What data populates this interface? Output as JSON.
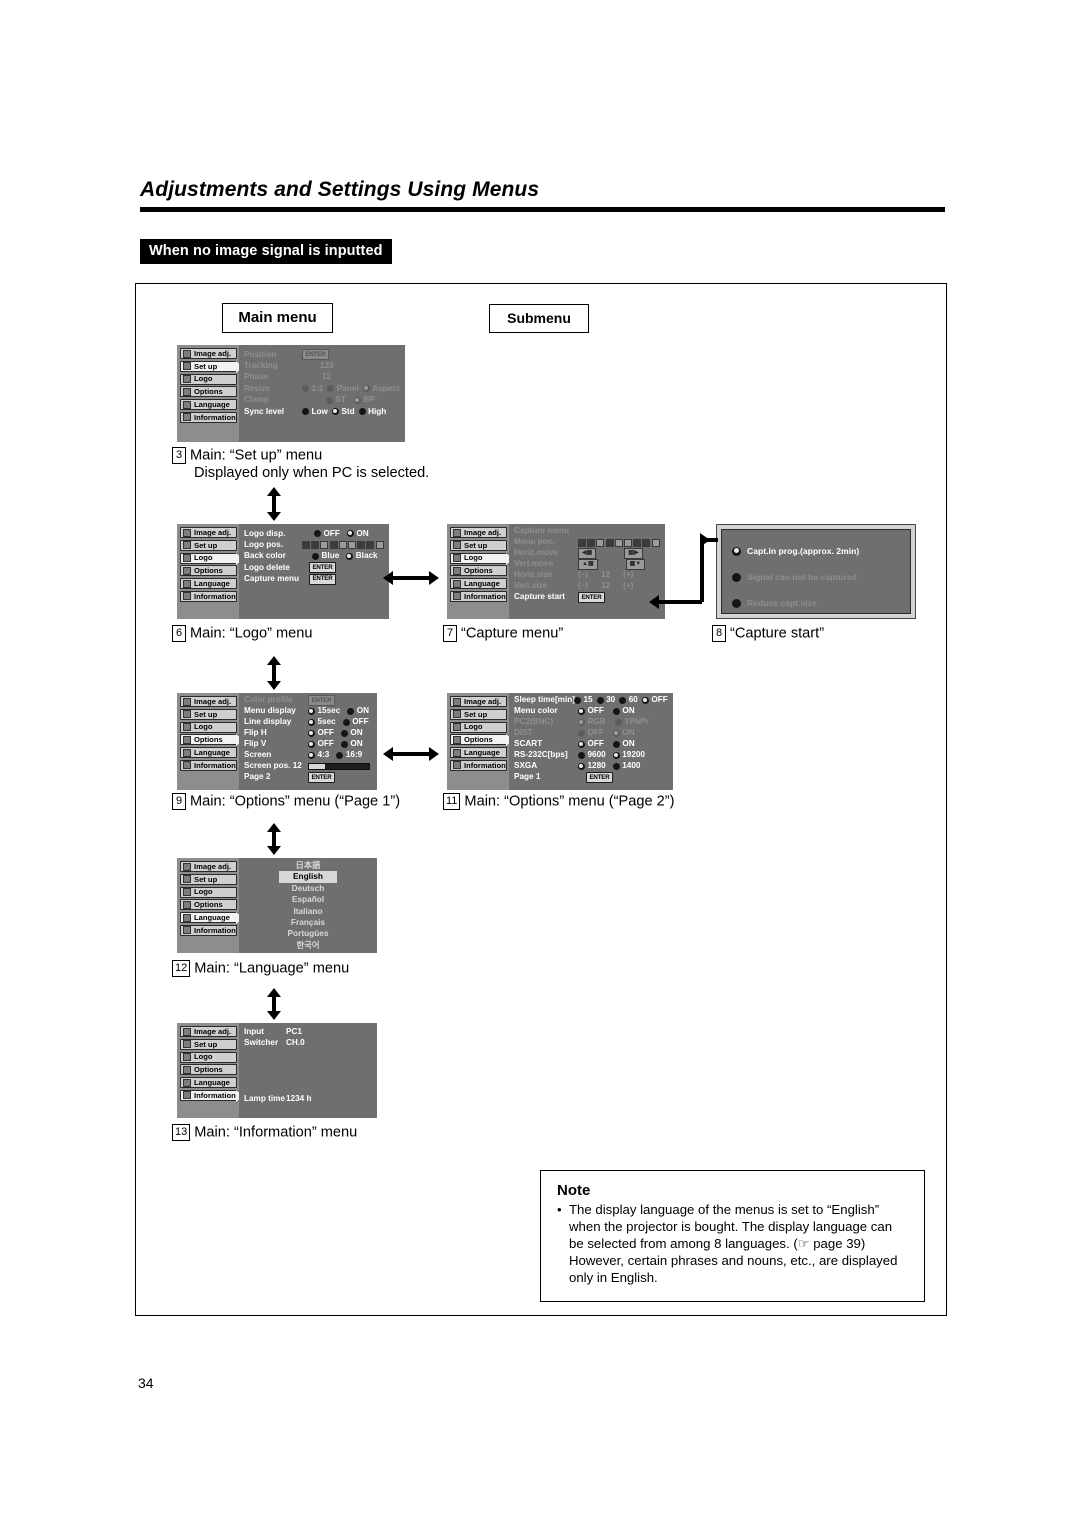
{
  "page": {
    "header_title": "Adjustments and Settings Using Menus",
    "section_tag": "When no image signal is inputted",
    "page_number": "34"
  },
  "legend": {
    "main_menu": "Main menu",
    "submenu": "Submenu"
  },
  "sidebar_items": [
    {
      "label": "Image adj.",
      "icon": "image-adjust-icon"
    },
    {
      "label": "Set up",
      "icon": "setup-icon"
    },
    {
      "label": "Logo",
      "icon": "logo-icon"
    },
    {
      "label": "Options",
      "icon": "options-icon"
    },
    {
      "label": "Language",
      "icon": "language-icon"
    },
    {
      "label": "Information",
      "icon": "information-icon"
    }
  ],
  "menus": {
    "setup": {
      "selected_sidebar": "Set up",
      "rows": [
        {
          "label": "Position",
          "dim": true,
          "value_type": "enter",
          "enter": "ENTER"
        },
        {
          "label": "Tracking",
          "dim": true,
          "value_type": "text",
          "text": "123"
        },
        {
          "label": "Phase",
          "dim": true,
          "value_type": "text",
          "text": "12"
        },
        {
          "label": "Resize",
          "dim": true,
          "value_type": "radio",
          "options": [
            "1:1",
            "Panel",
            "Aspect"
          ],
          "selected": "Aspect"
        },
        {
          "label": "Clamp",
          "dim": true,
          "value_type": "radio",
          "options": [
            "ST",
            "BP"
          ],
          "selected": "BP"
        },
        {
          "label": "Sync level",
          "dim": false,
          "value_type": "radio",
          "options": [
            "Low",
            "Std",
            "High"
          ],
          "selected": "Std"
        }
      ]
    },
    "logo": {
      "selected_sidebar": "Logo",
      "rows": [
        {
          "label": "Logo disp.",
          "dim": false,
          "value_type": "radio",
          "options": [
            "OFF",
            "ON"
          ],
          "selected": "ON"
        },
        {
          "label": "Logo pos.",
          "dim": false,
          "value_type": "posgrid"
        },
        {
          "label": "Back color",
          "dim": false,
          "value_type": "radio",
          "options": [
            "Blue",
            "Black"
          ],
          "selected": "Black"
        },
        {
          "label": "Logo delete",
          "dim": false,
          "value_type": "enter",
          "enter": "ENTER"
        },
        {
          "label": "Capture menu",
          "dim": false,
          "value_type": "enter",
          "enter": "ENTER"
        }
      ]
    },
    "capture": {
      "selected_sidebar": "Logo",
      "rows": [
        {
          "label": "Capture menu",
          "dim": true,
          "value_type": "none"
        },
        {
          "label": "Menu pos.",
          "dim": true,
          "value_type": "posgrid"
        },
        {
          "label": "Horiz.move",
          "dim": true,
          "value_type": "move",
          "left": "◀▦",
          "right": "▦▶"
        },
        {
          "label": "Vert.move",
          "dim": true,
          "value_type": "move",
          "left": "▲▦",
          "right": "▦▼"
        },
        {
          "label": "Horiz.size",
          "dim": true,
          "value_type": "step",
          "minus": "(–)",
          "value": "12",
          "plus": "(+)"
        },
        {
          "label": "Vert.size",
          "dim": true,
          "value_type": "step",
          "minus": "(–)",
          "value": "12",
          "plus": "(+)"
        },
        {
          "label": "Capture start",
          "dim": false,
          "value_type": "enter",
          "enter": "ENTER"
        }
      ]
    },
    "options_page1": {
      "selected_sidebar": "Options",
      "rows": [
        {
          "label": "Color profile",
          "dim": true,
          "value_type": "enter",
          "enter": "ENTER"
        },
        {
          "label": "Menu display",
          "dim": false,
          "value_type": "radio",
          "options": [
            "15sec",
            "ON"
          ],
          "selected": "15sec"
        },
        {
          "label": "Line display",
          "dim": false,
          "value_type": "radio",
          "options": [
            "5sec",
            "OFF"
          ],
          "selected": "5sec"
        },
        {
          "label": "Flip H",
          "dim": false,
          "value_type": "radio",
          "options": [
            "OFF",
            "ON"
          ],
          "selected": "OFF"
        },
        {
          "label": "Flip V",
          "dim": false,
          "value_type": "radio",
          "options": [
            "OFF",
            "ON"
          ],
          "selected": "OFF"
        },
        {
          "label": "Screen",
          "dim": false,
          "value_type": "radio",
          "options": [
            "4:3",
            "16:9"
          ],
          "selected": "4:3"
        },
        {
          "label": "Screen pos. 12",
          "dim": false,
          "value_type": "slider"
        },
        {
          "label": "Page 2",
          "dim": false,
          "value_type": "enter",
          "enter": "ENTER"
        }
      ]
    },
    "options_page2": {
      "selected_sidebar": "Options",
      "rows": [
        {
          "label": "Sleep time[min]",
          "dim": false,
          "value_type": "radio",
          "options": [
            "15",
            "30",
            "60",
            "OFF"
          ],
          "selected": "OFF"
        },
        {
          "label": "Menu color",
          "dim": false,
          "value_type": "radio",
          "options": [
            "OFF",
            "ON"
          ],
          "selected": "OFF"
        },
        {
          "label": "PC2(BNC)",
          "dim": true,
          "value_type": "radio",
          "options": [
            "RGB",
            "YPbPr"
          ],
          "selected": "RGB"
        },
        {
          "label": "DIST",
          "dim": true,
          "value_type": "radio",
          "options": [
            "OFF",
            "ON"
          ],
          "selected": "ON"
        },
        {
          "label": "SCART",
          "dim": false,
          "value_type": "radio",
          "options": [
            "OFF",
            "ON"
          ],
          "selected": "OFF"
        },
        {
          "label": "RS-232C[bps]",
          "dim": false,
          "value_type": "radio",
          "options": [
            "9600",
            "19200"
          ],
          "selected": "19200"
        },
        {
          "label": "SXGA",
          "dim": false,
          "value_type": "radio",
          "options": [
            "1280",
            "1400"
          ],
          "selected": "1280"
        },
        {
          "label": "Page 1",
          "dim": false,
          "value_type": "enter",
          "enter": "ENTER"
        }
      ]
    },
    "language": {
      "selected_sidebar": "Language",
      "options": [
        "日本語",
        "English",
        "Deutsch",
        "Español",
        "Italiano",
        "Français",
        "Portugûes",
        "한국어"
      ],
      "selected": "English"
    },
    "information": {
      "selected_sidebar": "Information",
      "rows": [
        {
          "label": "Input",
          "value": "PC1"
        },
        {
          "label": "Switcher",
          "value": "CH.0"
        },
        {
          "label": "Lamp time",
          "value": "1234 h"
        }
      ]
    }
  },
  "capture_dialog": {
    "lines": [
      {
        "text": "Capt.in prog.(approx. 2min)",
        "dim": false,
        "selected": true
      },
      {
        "text": "Signal can not be captured",
        "dim": true,
        "selected": false
      },
      {
        "text": "Reduce capt.size",
        "dim": true,
        "selected": false
      }
    ]
  },
  "captions": {
    "setup": {
      "num": "3",
      "text": "Main: “Set up” menu",
      "sub": "Displayed only when PC is selected."
    },
    "logo": {
      "num": "6",
      "text": "Main: “Logo” menu"
    },
    "capture": {
      "num": "7",
      "text": "“Capture menu”"
    },
    "capture_start": {
      "num": "8",
      "text": "“Capture start”"
    },
    "options1": {
      "num": "9",
      "text": "Main: “Options” menu (“Page 1”)"
    },
    "options2": {
      "num": "11",
      "text": "Main: “Options” menu (“Page 2”)"
    },
    "language": {
      "num": "12",
      "text": "Main: “Language” menu"
    },
    "information": {
      "num": "13",
      "text": "Main: “Information” menu"
    }
  },
  "note": {
    "title": "Note",
    "bullet": "•",
    "text": "The display language of the menus is set to “English” when the projector is bought. The display language can be selected from among 8 languages. (☞ page 39) However, certain phrases and nouns, etc., are displayed only in English."
  }
}
